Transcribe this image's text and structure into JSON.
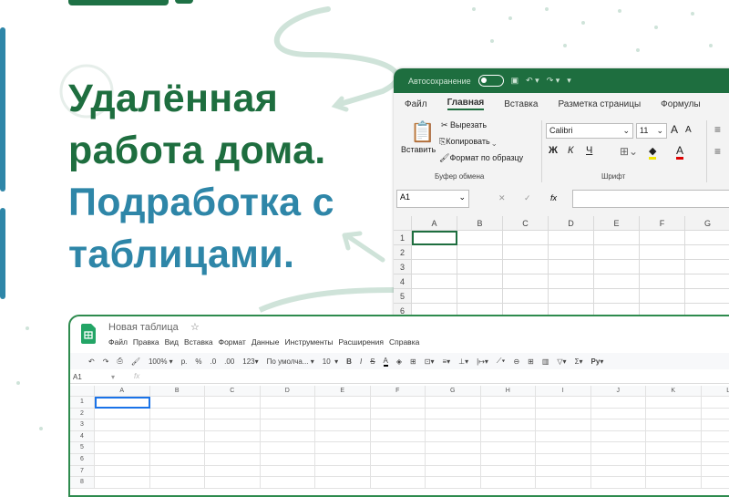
{
  "headline": {
    "line1": "Удалённая",
    "line2": "работа дома.",
    "line3": "Подработка с",
    "line4": "таблицами."
  },
  "colors": {
    "green": "#1e6e3f",
    "blue": "#2e86a8"
  },
  "excel": {
    "autosave_label": "Автосохранение",
    "tabs": [
      "Файл",
      "Главная",
      "Вставка",
      "Разметка страницы",
      "Формулы"
    ],
    "clipboard": {
      "paste": "Вставить",
      "cut": "Вырезать",
      "copy": "Копировать",
      "format_painter": "Формат по образцу",
      "group": "Буфер обмена"
    },
    "font": {
      "name": "Calibri",
      "size": "11",
      "bold": "Ж",
      "italic": "К",
      "underline": "Ч",
      "group": "Шрифт",
      "grow": "A",
      "shrink": "A",
      "color": "A"
    },
    "name_box": "A1",
    "fx": "fx",
    "columns": [
      "A",
      "B",
      "C",
      "D",
      "E",
      "F",
      "G"
    ],
    "rows": [
      "1",
      "2",
      "3",
      "4",
      "5",
      "6"
    ]
  },
  "gsheets": {
    "title": "Новая таблица",
    "menu": [
      "Файл",
      "Правка",
      "Вид",
      "Вставка",
      "Формат",
      "Данные",
      "Инструменты",
      "Расширения",
      "Справка"
    ],
    "toolbar": {
      "zoom": "100%",
      "currency": "р.",
      "percent": "%",
      "dec_less": ".0",
      "dec_more": ".00",
      "format": "123",
      "font": "По умолча...",
      "size": "10",
      "bold": "B",
      "italic": "I",
      "strike": "S",
      "color": "A"
    },
    "name_box": "A1",
    "fx": "fx",
    "columns": [
      "A",
      "B",
      "C",
      "D",
      "E",
      "F",
      "G",
      "H",
      "I",
      "J",
      "K",
      "L"
    ],
    "rows": [
      "1",
      "2",
      "3",
      "4",
      "5",
      "6",
      "7",
      "8"
    ]
  }
}
